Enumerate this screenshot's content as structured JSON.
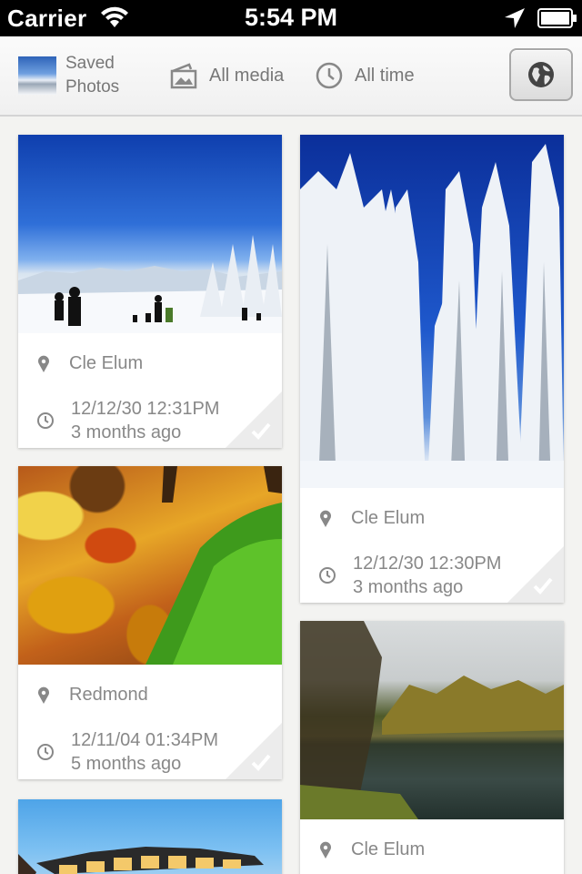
{
  "status_bar": {
    "carrier": "Carrier",
    "time": "5:54 PM"
  },
  "filter_bar": {
    "album_line1": "Saved",
    "album_line2": "Photos",
    "media_filter": "All media",
    "time_filter": "All time",
    "globe_icon": "globe-icon"
  },
  "cards": [
    {
      "location": "Cle Elum",
      "date": "12/12/30 12:31PM",
      "relative": "3 months ago"
    },
    {
      "location": "Cle Elum",
      "date": "12/12/30 12:30PM",
      "relative": "3 months ago"
    },
    {
      "location": "Redmond",
      "date": "12/11/04 01:34PM",
      "relative": "5 months ago"
    },
    {
      "location": "Cle Elum"
    }
  ],
  "colors": {
    "status_bar_bg": "#000000",
    "page_bg": "#f3f3f1",
    "card_text": "#888888"
  }
}
